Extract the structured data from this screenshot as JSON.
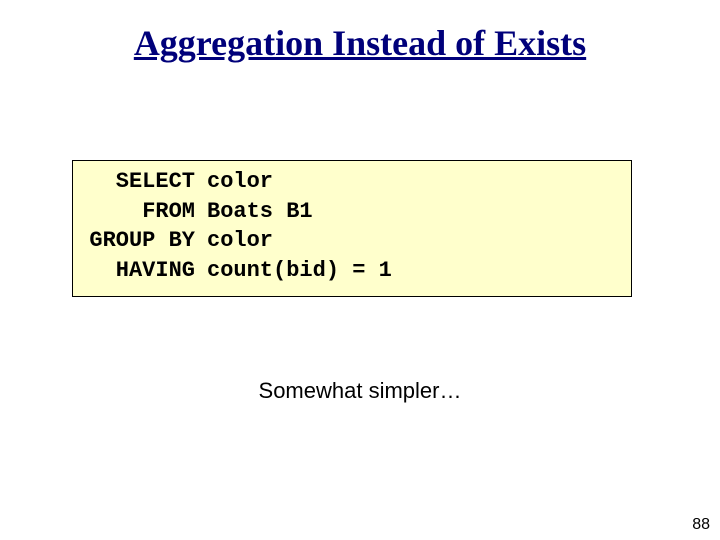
{
  "title": "Aggregation Instead of Exists",
  "code": {
    "rows": [
      {
        "kw": "SELECT",
        "arg": "color"
      },
      {
        "kw": "FROM",
        "arg": "Boats B1"
      },
      {
        "kw": "GROUP BY",
        "arg": "color"
      },
      {
        "kw": "HAVING",
        "arg": "count(bid) = 1"
      }
    ]
  },
  "note": "Somewhat simpler…",
  "page_number": "88"
}
